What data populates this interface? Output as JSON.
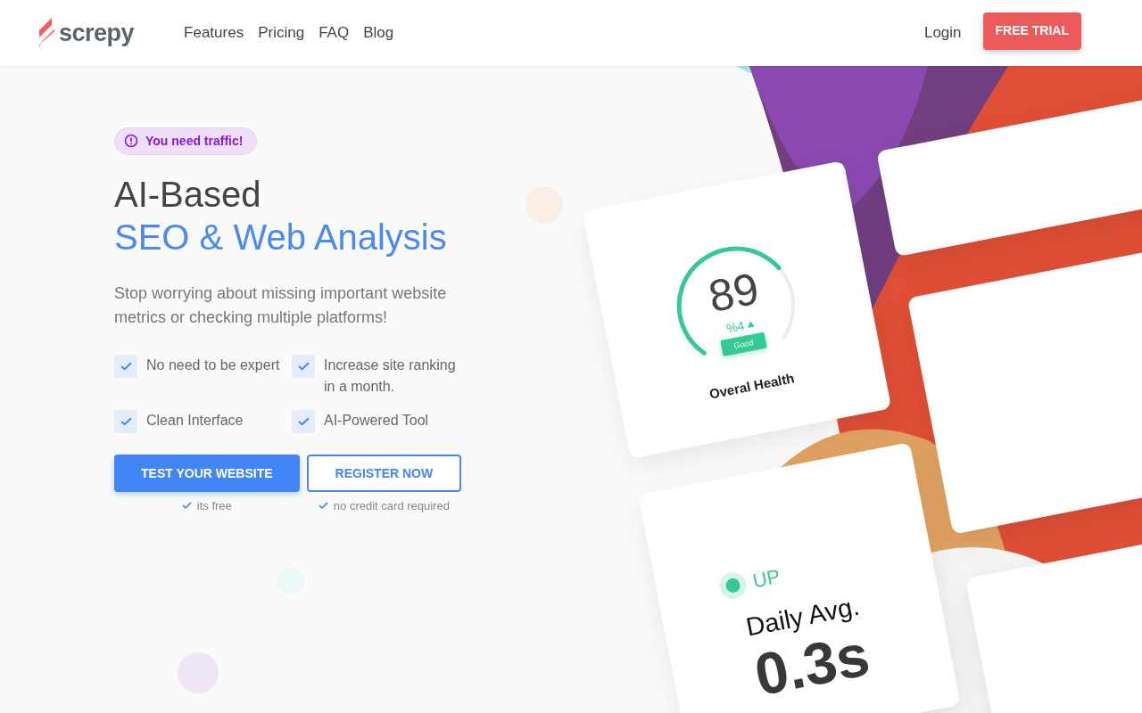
{
  "header": {
    "logo": "screpy",
    "nav": [
      "Features",
      "Pricing",
      "FAQ",
      "Blog"
    ],
    "login": "Login",
    "cta": "FREE TRIAL"
  },
  "hero": {
    "badge": "You need traffic!",
    "title": "AI-Based",
    "title_accent": "SEO & Web Analysis",
    "lead": "Stop worrying about missing important website metrics or checking multiple platforms!",
    "features": [
      "No need to be expert",
      "Increase site ranking in a month.",
      "Clean Interface",
      "AI-Powered Tool"
    ],
    "buttons": [
      {
        "label": "TEST YOUR WEBSITE",
        "kind": "primary",
        "note": "its free"
      },
      {
        "label": "REGISTER NOW",
        "kind": "outline",
        "note": "no credit card required"
      }
    ]
  },
  "illustration": {
    "health_card": {
      "score": "89",
      "change": "%4",
      "status": "Good",
      "label": "Overal Health"
    },
    "uptime_card": {
      "status": "UP",
      "label": "Daily Avg.",
      "value": "0.3s"
    }
  }
}
